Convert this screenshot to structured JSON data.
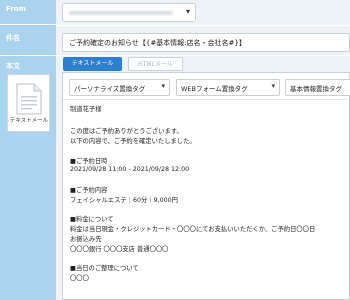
{
  "sidebar": {
    "from_label": "From",
    "subject_label": "件名",
    "body_label": "本文",
    "attachment_label": "テキストメール",
    "icon": "document-icon"
  },
  "from_field": {
    "value": "",
    "icon": "chevron-down-icon"
  },
  "subject_field": {
    "value": "ご予約確定のお知らせ【{#基本情報:店名・会社名#}】"
  },
  "tabs": {
    "text_mail": "テキストメール",
    "html_mail": "HTMLメール"
  },
  "tag_selects": [
    {
      "label": "パーソナライズ置換タグ"
    },
    {
      "label": "WEBフォーム置換タグ"
    },
    {
      "label": "基本情報置換タグ"
    }
  ],
  "body_lines": [
    "制道花子様",
    "",
    "この度はご予約ありがとうございます。",
    "以下の内容で、ご予約を確定いたしました。",
    "",
    "■ご予約日時",
    "2021/09/28 11:00 - 2021/09/28 12:00",
    "",
    "■ご予約内容",
    "フェイシャルエステ｜60分｜9,000円",
    "",
    "■料金について",
    "料金は当日現金・クレジットカード・〇〇〇にてお支払いいただくか、ご予約日〇〇日",
    "お振込み先",
    "〇〇〇銀行 〇〇〇支店 普通〇〇〇",
    "",
    "■当日のご整理について",
    "〇〇〇"
  ],
  "colors": {
    "sidebar_bg": "#aad4ee",
    "content_bg": "#eef3f7",
    "accent_blue": "#2b7fd0"
  }
}
